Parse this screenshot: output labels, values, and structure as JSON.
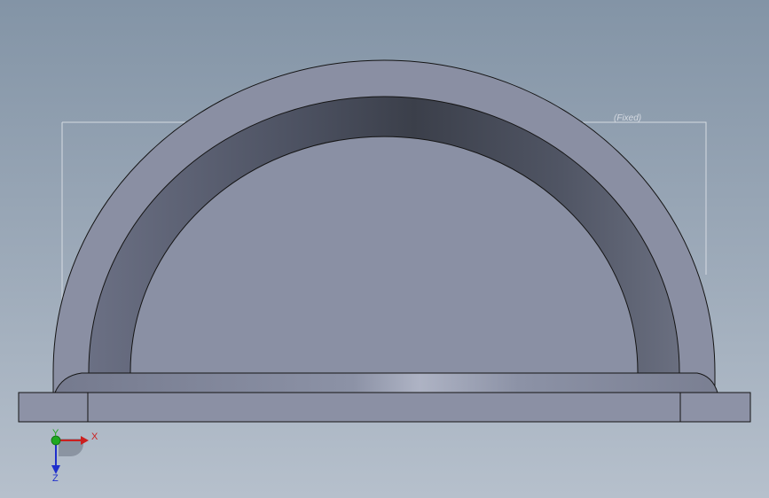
{
  "viewport": {
    "sketch_label": "(Fixed)",
    "background_top": "#8394a6",
    "background_bottom": "#b6c0cc"
  },
  "model": {
    "shape": "half-ring arch on base plate",
    "body_color": "#8a90a4",
    "inner_band_color": "#3e434e",
    "edge_color": "#1a1a1a"
  },
  "triad": {
    "x_label": "X",
    "y_label": "Y",
    "z_label": "Z",
    "x_color": "#cc1f1f",
    "y_color": "#1fa81f",
    "z_color": "#1f2fcc"
  }
}
